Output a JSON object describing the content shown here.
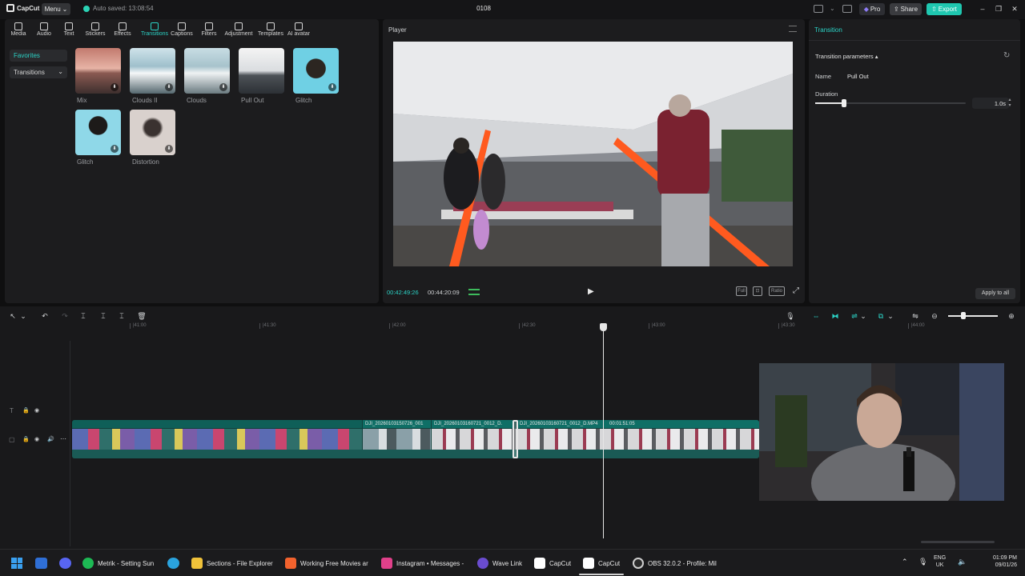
{
  "titlebar": {
    "app_name": "CapCut",
    "menu_label": "Menu",
    "autosave": "Auto saved: 13:08:54",
    "project_title": "0108",
    "pro_label": "Pro",
    "share_label": "Share",
    "export_label": "Export"
  },
  "toolbar": [
    {
      "label": "Media",
      "icon": "media-icon"
    },
    {
      "label": "Audio",
      "icon": "audio-icon"
    },
    {
      "label": "Text",
      "icon": "text-icon"
    },
    {
      "label": "Stickers",
      "icon": "stickers-icon"
    },
    {
      "label": "Effects",
      "icon": "effects-icon"
    },
    {
      "label": "Transitions",
      "icon": "transitions-icon"
    },
    {
      "label": "Captions",
      "icon": "captions-icon"
    },
    {
      "label": "Filters",
      "icon": "filters-icon"
    },
    {
      "label": "Adjustment",
      "icon": "adjustment-icon"
    },
    {
      "label": "Templates",
      "icon": "templates-icon"
    },
    {
      "label": "AI avatar",
      "icon": "ai-avatar-icon"
    }
  ],
  "sidebar": {
    "favorites": "Favorites",
    "transitions": "Transitions"
  },
  "transitions": [
    {
      "label": "Mix"
    },
    {
      "label": "Clouds II"
    },
    {
      "label": "Clouds"
    },
    {
      "label": "Pull Out"
    },
    {
      "label": "Glitch"
    },
    {
      "label": "Glitch"
    },
    {
      "label": "Distortion"
    }
  ],
  "player": {
    "title": "Player",
    "current_time": "00:42:49:26",
    "total_time": "00:44:20:09",
    "full_label": "Full",
    "ratio_label": "Ratio"
  },
  "transition_panel": {
    "header": "Transition",
    "params_label": "Transition parameters",
    "name_label": "Name",
    "name_value": "Pull Out",
    "duration_label": "Duration",
    "duration_value": "1.0s",
    "duration_fraction": 0.19,
    "apply_all": "Apply to all"
  },
  "timeline": {
    "ruler": [
      "|41:00",
      "|41:30",
      "|42:00",
      "|42:30",
      "|43:00",
      "|43:30",
      "|44:00"
    ],
    "clips": [
      "DJI_20260103150726_001",
      "DJI_20260103160721_0012_D.",
      "DJI_20260103160721_0012_D.MP4",
      "00:01:51:05"
    ]
  },
  "taskbar": {
    "items": [
      {
        "label": "Metrik - Setting Sun",
        "color": "#1db954"
      },
      {
        "label": "Sections - File Explorer",
        "color": "#f0c23a"
      },
      {
        "label": "Working Free Movies ar",
        "color": "#f2622d"
      },
      {
        "label": "Instagram • Messages -",
        "color": "#e0408a"
      },
      {
        "label": "Wave Link",
        "color": "#6a4ccf"
      },
      {
        "label": "CapCut",
        "color": "#ffffff"
      },
      {
        "label": "CapCut",
        "color": "#ffffff"
      },
      {
        "label": "OBS 32.0.2 - Profile: Mil",
        "color": "#cfcfcf"
      }
    ],
    "lang_top": "ENG",
    "lang_bottom": "UK",
    "time": "01:09 PM",
    "date": "09/01/26"
  },
  "colors": {
    "accent": "#2bd3c6",
    "export": "#1fc7b0",
    "track": "#0f6f66"
  }
}
